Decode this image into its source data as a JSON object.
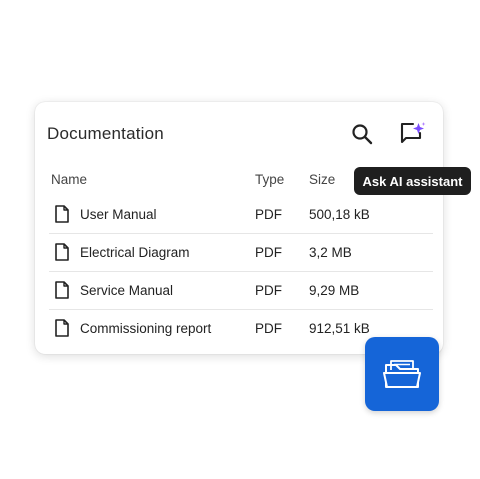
{
  "card": {
    "title": "Documentation",
    "search_icon": "search-icon",
    "ai_icon": "ai-chat-sparkle-icon"
  },
  "tooltip": {
    "text": "Ask AI assistant"
  },
  "table": {
    "columns": {
      "name": "Name",
      "type": "Type",
      "size": "Size"
    },
    "rows": [
      {
        "name": "User Manual",
        "type": "PDF",
        "size": "500,18 kB",
        "icon": "document-icon"
      },
      {
        "name": "Electrical Diagram",
        "type": "PDF",
        "size": "3,2 MB",
        "icon": "document-icon"
      },
      {
        "name": "Service Manual",
        "type": "PDF",
        "size": "9,29 MB",
        "icon": "document-icon"
      },
      {
        "name": "Commissioning report",
        "type": "PDF",
        "size": "912,51 kB",
        "icon": "document-icon"
      }
    ]
  },
  "folder_button": {
    "icon": "open-folder-icon",
    "color": "#1565d8"
  },
  "colors": {
    "ai_sparkle": "#7b4dff",
    "tooltip_bg": "#1f1f1f"
  }
}
